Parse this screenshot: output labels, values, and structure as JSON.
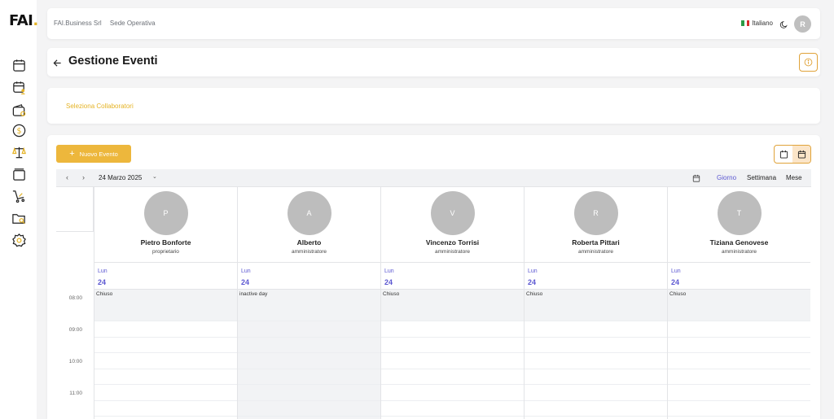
{
  "app": {
    "logo_text": "FAI",
    "logo_dot": "."
  },
  "sidebar": {
    "items": [
      {
        "icon": "calendar-icon"
      },
      {
        "icon": "calendar-user-icon"
      },
      {
        "icon": "wallet-settings-icon"
      },
      {
        "icon": "dollar-coin-icon"
      },
      {
        "icon": "balance-scale-icon"
      },
      {
        "icon": "inbox-tray-icon"
      },
      {
        "icon": "shopping-cart-icon"
      },
      {
        "icon": "folder-search-icon"
      },
      {
        "icon": "gear-icon"
      }
    ]
  },
  "topbar": {
    "company": "FAI.Business Srl",
    "branch": "Sede Operativa",
    "language": "Italiano",
    "avatar_initial": "R"
  },
  "header": {
    "title": "Gestione Eventi"
  },
  "collaborators": {
    "link": "Seleziona Collaboratori"
  },
  "toolbar": {
    "new_event": "Nuovo Evento"
  },
  "calendar": {
    "date": "24 Marzo 2025",
    "views": [
      "Giorno",
      "Settimana",
      "Mese"
    ],
    "active_view": "Giorno",
    "times": [
      "08:00",
      "09:00",
      "10:00",
      "11:00"
    ],
    "columns": [
      {
        "initial": "P",
        "name": "Pietro Bonforte",
        "role": "proprietario",
        "day": "Lun",
        "date": "24",
        "first_slot": "Chiuso",
        "inactive": false
      },
      {
        "initial": "A",
        "name": "Alberto",
        "role": "amministratore",
        "day": "Lun",
        "date": "24",
        "first_slot": "inactive day",
        "inactive": true
      },
      {
        "initial": "V",
        "name": "Vincenzo Torrisi",
        "role": "amministratore",
        "day": "Lun",
        "date": "24",
        "first_slot": "Chiuso",
        "inactive": false
      },
      {
        "initial": "R",
        "name": "Roberta Pittari",
        "role": "amministratore",
        "day": "Lun",
        "date": "24",
        "first_slot": "Chiuso",
        "inactive": false
      },
      {
        "initial": "T",
        "name": "Tiziana Genovese",
        "role": "amministratore",
        "day": "Lun",
        "date": "24",
        "first_slot": "Chiuso",
        "inactive": false
      }
    ]
  },
  "colors": {
    "accent": "#edb73c",
    "link": "#5b57d1",
    "logo_dot": "#e5b325"
  }
}
